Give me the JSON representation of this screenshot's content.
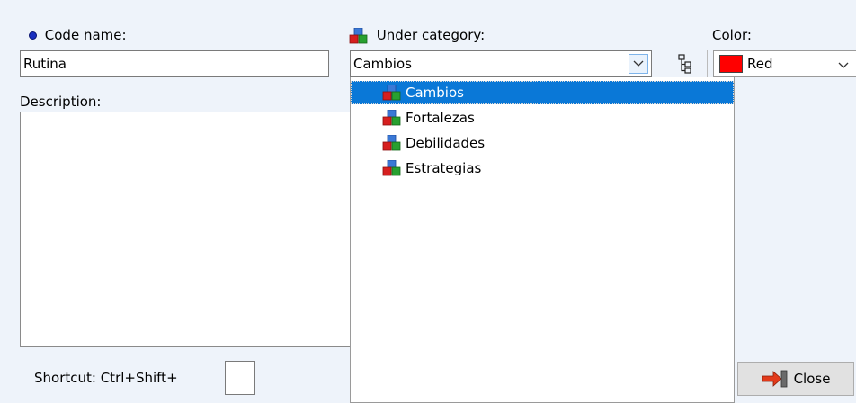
{
  "code_name": {
    "label": "Code name:",
    "value": "Rutina",
    "bullet_color": "#1a2fbf"
  },
  "category": {
    "label": "Under category:",
    "selected": "Cambios",
    "options": [
      "Cambios",
      "Fortalezas",
      "Debilidades",
      "Estrategias"
    ],
    "selected_index": 0,
    "icon": "category-cubes-icon",
    "tree_button_icon": "hierarchy-icon"
  },
  "color": {
    "label": "Color:",
    "value": "Red",
    "swatch": "#ff0000"
  },
  "description": {
    "label": "Description:",
    "value": ""
  },
  "shortcut": {
    "label": "Shortcut: Ctrl+Shift+",
    "key": ""
  },
  "close_button": {
    "label": "Close",
    "icon": "exit-arrow-icon"
  },
  "theme": {
    "background": "#eef3fa",
    "selection": "#0a78d7"
  }
}
